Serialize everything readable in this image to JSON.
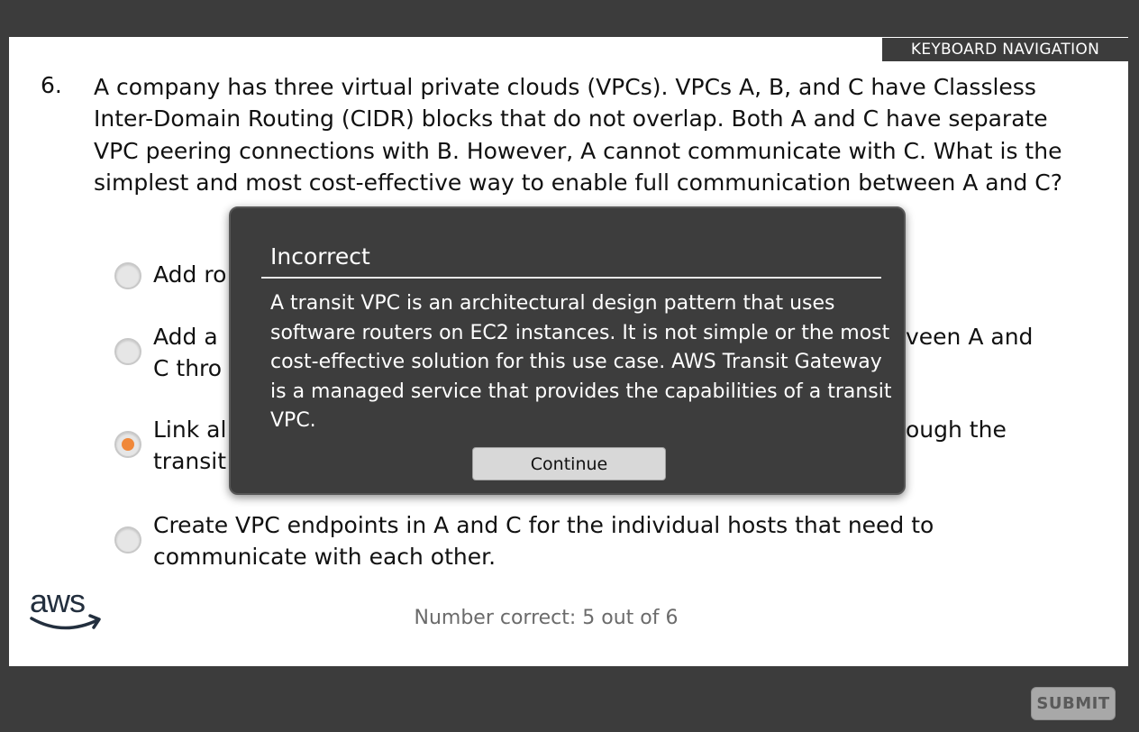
{
  "header": {
    "keyboard_nav_label": "KEYBOARD NAVIGATION"
  },
  "question": {
    "number": "6.",
    "text": "A company has three virtual private clouds (VPCs). VPCs A, B, and C have Classless Inter-Domain Routing (CIDR) blocks that do not overlap. Both A and C have separate VPC peering connections with B. However, A cannot communicate with C. What is the simplest and most cost-effective way to enable full communication between A and C?"
  },
  "options": [
    {
      "lines": [
        "Add ro"
      ],
      "selected": false
    },
    {
      "lines": [
        "Add a",
        "C thro"
      ],
      "selected": false
    },
    {
      "lines": [
        "Link al",
        "transit"
      ],
      "selected": true
    },
    {
      "lines": [
        "Create VPC endpoints in A and C for the individual hosts that need to",
        "communicate with each other."
      ],
      "selected": false
    }
  ],
  "partial_visible": {
    "option2_tail": "veen A and",
    "option3_tail": "ough the"
  },
  "feedback_dialog": {
    "title": "Incorrect",
    "body": "A transit VPC is an architectural design pattern that uses software routers on EC2 instances. It is not simple or the most cost-effective solution for this use case. AWS Transit Gateway is a managed service that provides the capabilities of a transit VPC.",
    "continue_label": "Continue"
  },
  "footer": {
    "logo_text": "aws",
    "score_text": "Number correct: 5 out of 6",
    "submit_label": "SUBMIT"
  },
  "colors": {
    "background": "#3c3c3c",
    "panel": "#ffffff",
    "dialog": "#3d3d3d",
    "selected_radio": "#f0883a",
    "aws_logo": "#232f3e"
  }
}
